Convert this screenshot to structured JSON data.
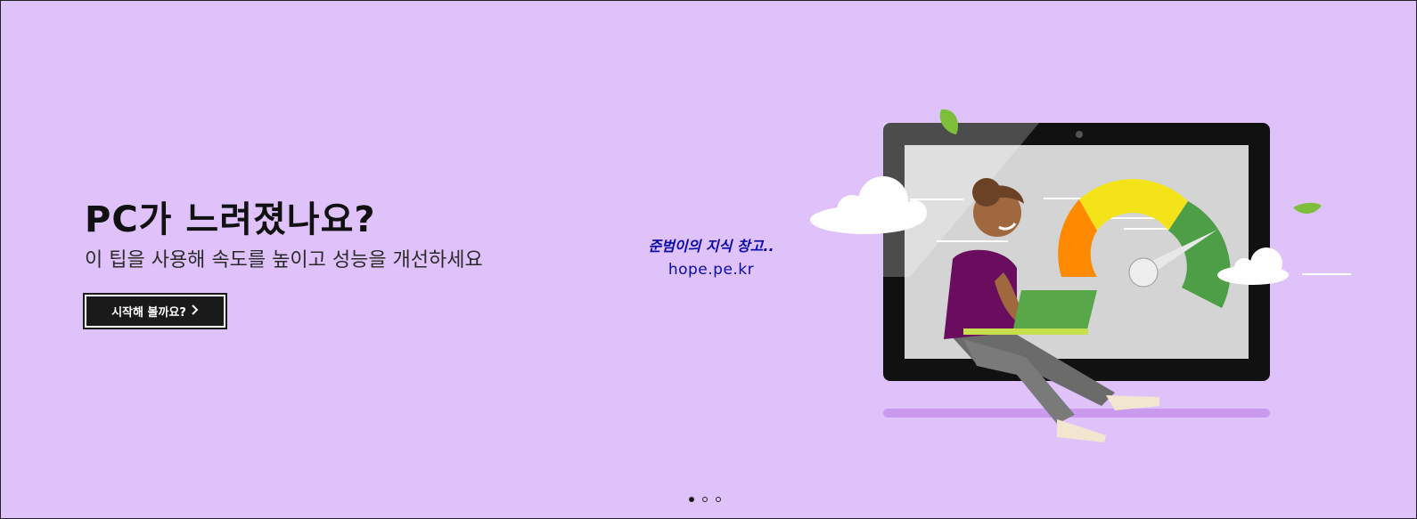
{
  "hero": {
    "headline": "PC가 느려졌나요?",
    "subline": "이 팁을 사용해 속도를 높이고 성능을 개선하세요",
    "cta_label": "시작해 볼까요?",
    "cta_icon": "chevron-right-icon",
    "background_color": "#e0c2fb"
  },
  "watermark": {
    "line1": "준범이의 지식 창고..",
    "line2": "hope.pe.kr"
  },
  "carousel": {
    "slide_count": 3,
    "active_index": 0
  }
}
